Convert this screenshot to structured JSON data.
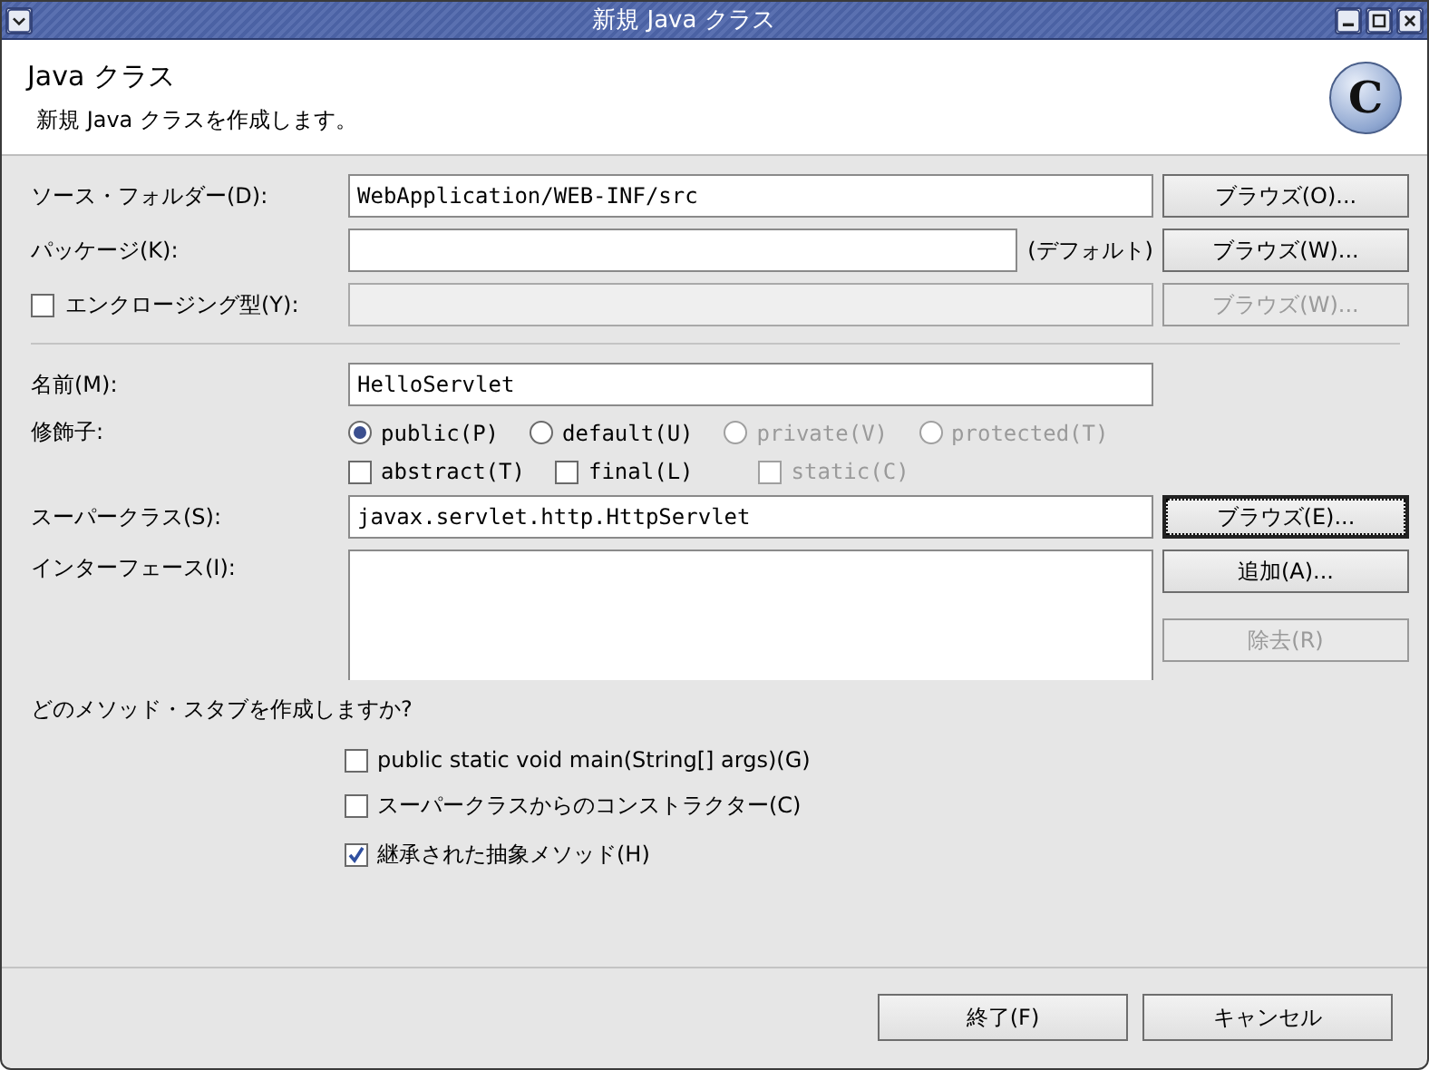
{
  "window": {
    "title": "新規 Java クラス"
  },
  "header": {
    "title": "Java クラス",
    "description": "新規 Java クラスを作成します。",
    "icon_letter": "C"
  },
  "location_rows": [
    {
      "kind": "text",
      "label": "ソース・フォルダー(D):",
      "value": "WebApplication/WEB-INF/src",
      "disabled": false,
      "button": {
        "label": "ブラウズ(O)...",
        "disabled": false
      }
    },
    {
      "kind": "text",
      "label": "パッケージ(K):",
      "suffix": "(デフォルト)",
      "disabled": false,
      "button": {
        "label": "ブラウズ(W)...",
        "disabled": false
      }
    },
    {
      "kind": "checkbox",
      "label": "エンクロージング型(Y):",
      "checked": false,
      "disabled": true,
      "button": {
        "label": "ブラウズ(W)...",
        "disabled": true
      }
    }
  ],
  "name": {
    "label": "名前(M):",
    "value": "HelloServlet"
  },
  "modifiers": {
    "label": "修飾子:",
    "access": [
      {
        "label": "public(P)",
        "selected": true,
        "disabled": false
      },
      {
        "label": "default(U)",
        "selected": false,
        "disabled": false
      },
      {
        "label": "private(V)",
        "selected": false,
        "disabled": true
      },
      {
        "label": "protected(T)",
        "selected": false,
        "disabled": true
      }
    ],
    "flags": [
      {
        "label": "abstract(T)",
        "checked": false,
        "disabled": false
      },
      {
        "label": "final(L)",
        "checked": false,
        "disabled": false
      },
      {
        "label": "static(C)",
        "checked": false,
        "disabled": true
      }
    ]
  },
  "superclass": {
    "label": "スーパークラス(S):",
    "value": "javax.servlet.http.HttpServlet",
    "button": {
      "label": "ブラウズ(E)...",
      "focused": true
    }
  },
  "interfaces": {
    "label": "インターフェース(I):",
    "buttons": [
      {
        "label": "追加(A)...",
        "disabled": false
      },
      {
        "label": "除去(R)",
        "disabled": true
      }
    ]
  },
  "stubs": {
    "question": "どのメソッド・スタブを作成しますか?",
    "options": [
      {
        "label": "public static void main(String[] args)(G)",
        "checked": false
      },
      {
        "label": "スーパークラスからのコンストラクター(C)",
        "checked": false
      },
      {
        "label": "継承された抽象メソッド(H)",
        "checked": true
      }
    ]
  },
  "buttons": [
    {
      "label": "終了(F)"
    },
    {
      "label": "キャンセル"
    }
  ]
}
